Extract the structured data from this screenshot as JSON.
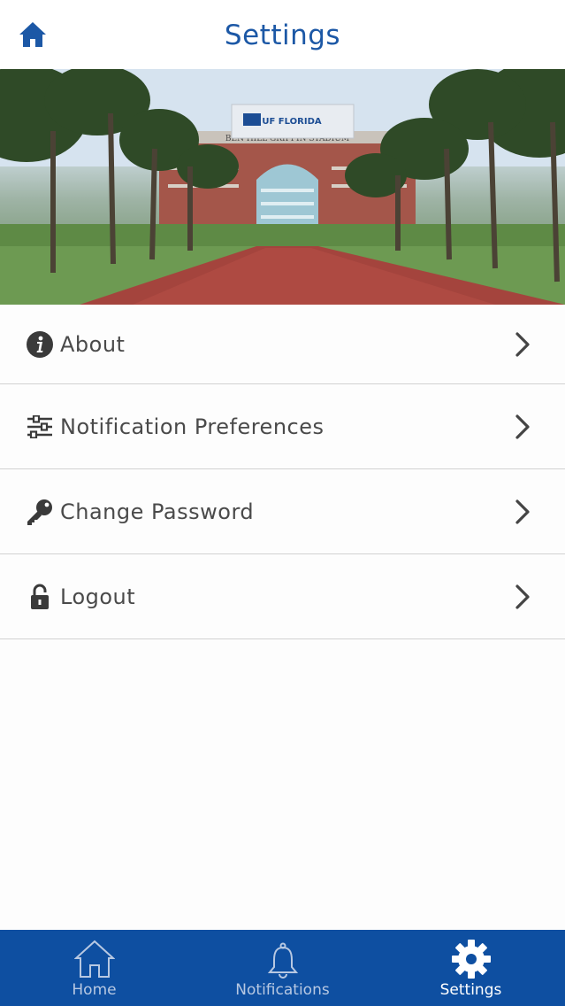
{
  "header": {
    "title": "Settings",
    "home_icon": "home-icon"
  },
  "hero": {
    "description_icon": "stadium-photo",
    "sign_text": "UF FLORIDA",
    "stadium_text": "BEN HILL GRIFFIN STADIUM"
  },
  "menu": {
    "items": [
      {
        "label": "About",
        "icon": "info-icon"
      },
      {
        "label": "Notification Preferences",
        "icon": "sliders-icon"
      },
      {
        "label": "Change Password",
        "icon": "key-icon"
      },
      {
        "label": "Logout",
        "icon": "lock-icon"
      }
    ]
  },
  "tabbar": {
    "tabs": [
      {
        "label": "Home",
        "icon": "home-outline-icon",
        "active": false
      },
      {
        "label": "Notifications",
        "icon": "bell-icon",
        "active": false
      },
      {
        "label": "Settings",
        "icon": "gear-icon",
        "active": true
      }
    ]
  },
  "colors": {
    "accent": "#1c58a6",
    "tabbar_bg": "#0e4fa1",
    "text": "#4a4a4a"
  }
}
